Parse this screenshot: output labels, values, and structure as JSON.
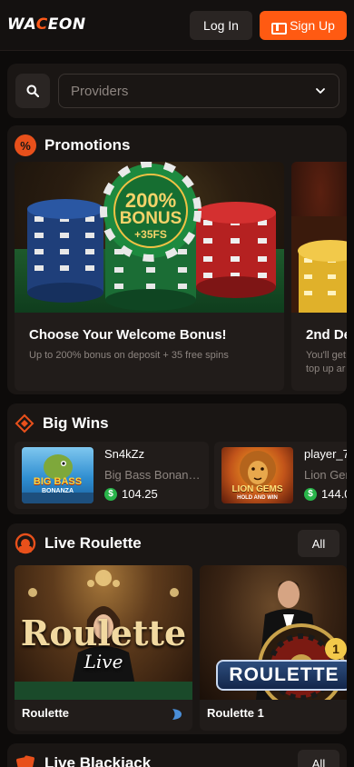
{
  "header": {
    "logo_main": "WA",
    "logo_accent": "C",
    "logo_rest": "EON",
    "login_label": "Log In",
    "signup_label": "Sign Up"
  },
  "filters": {
    "providers_placeholder": "Providers"
  },
  "promotions": {
    "title": "Promotions",
    "icon_glyph": "%",
    "items": [
      {
        "art_badge_line1": "200%",
        "art_badge_line2": "BONUS",
        "art_badge_line3": "+35FS",
        "title": "Choose Your Welcome Bonus!",
        "subtitle": "Up to 200% bonus on deposit + 35 free spins"
      },
      {
        "title": "2nd De",
        "subtitle_line1": "You'll get",
        "subtitle_line2": "top up ar"
      }
    ]
  },
  "big_wins": {
    "title": "Big Wins",
    "items": [
      {
        "user": "Sn4kZz",
        "game": "Big Bass Bonan…",
        "amount": "104.25",
        "thumb_text": "BIG BASS",
        "thumb_sub": "BONANZA"
      },
      {
        "user": "player_7",
        "game": "Lion Gem",
        "amount": "144.0",
        "thumb_text": "LION GEMS",
        "thumb_sub": "HOLD AND WIN"
      }
    ]
  },
  "live_roulette": {
    "title": "Live Roulette",
    "all_label": "All",
    "items": [
      {
        "name": "Roulette",
        "art_title": "Roulette",
        "art_sub": "Live"
      },
      {
        "name": "Roulette 1",
        "art_title": "ROULETTE",
        "art_badge": "1"
      }
    ]
  },
  "live_blackjack": {
    "title": "Live Blackjack",
    "all_label": "All"
  },
  "colors": {
    "accent": "#ff5a12",
    "background": "#0d0b0a",
    "card": "#1a1614",
    "win_coin": "#29b54a"
  }
}
